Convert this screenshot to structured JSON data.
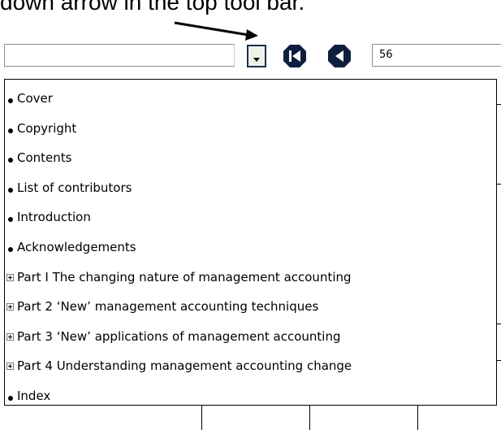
{
  "caption": {
    "text": "down arrow in the top tool bar."
  },
  "toolbar": {
    "toc_select_value": "",
    "page_number": "56"
  },
  "toc": {
    "items": [
      {
        "label": "Cover",
        "marker": "bullet"
      },
      {
        "label": "Copyright",
        "marker": "bullet"
      },
      {
        "label": "Contents",
        "marker": "bullet"
      },
      {
        "label": "List of contributors",
        "marker": "bullet"
      },
      {
        "label": "Introduction",
        "marker": "bullet"
      },
      {
        "label": "Acknowledgements",
        "marker": "bullet"
      },
      {
        "label": "Part I The changing nature of management accounting",
        "marker": "expand"
      },
      {
        "label": "Part 2 ‘New’ management accounting techniques",
        "marker": "expand"
      },
      {
        "label": "Part 3 ‘New’ applications of management accounting",
        "marker": "expand"
      },
      {
        "label": "Part 4 Understanding management accounting change",
        "marker": "expand"
      },
      {
        "label": "Index",
        "marker": "bullet"
      }
    ]
  },
  "colors": {
    "nav_icon": "#0d1e3f",
    "dropdown_border": "#1b2f4c"
  }
}
